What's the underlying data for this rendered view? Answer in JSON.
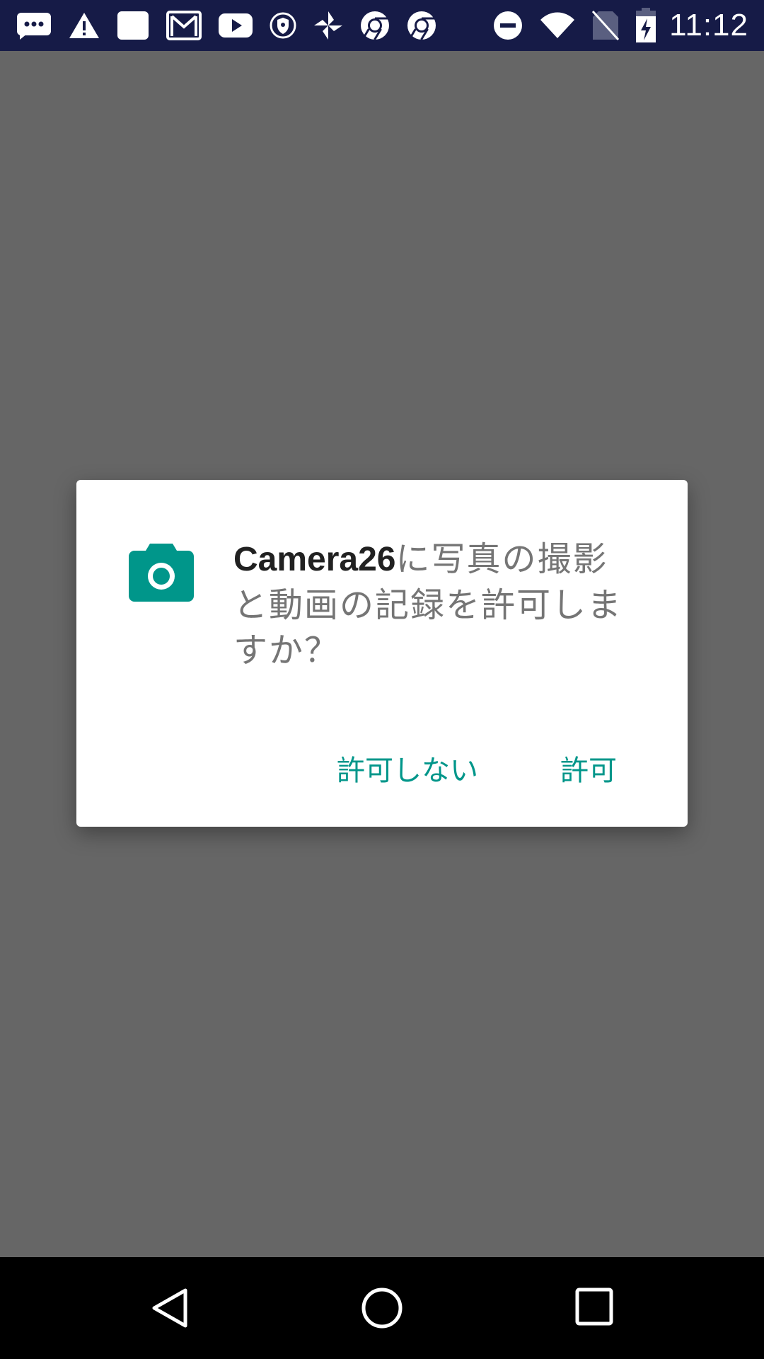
{
  "status_bar": {
    "time": "11:12",
    "left_icons": [
      "messages-icon",
      "warning-icon",
      "blank-app-icon",
      "gmail-icon",
      "youtube-icon",
      "shield-icon",
      "pinwheel-icon",
      "chrome-icon",
      "chrome-icon"
    ],
    "right_icons": [
      "do-not-disturb-icon",
      "wifi-icon",
      "no-sim-icon",
      "battery-charging-icon"
    ]
  },
  "dialog": {
    "icon": "camera-icon",
    "app_name": "Camera26",
    "message_rest": "に写真の撮影と動画の記録を許可しますか？",
    "deny_label": "許可しない",
    "allow_label": "許可",
    "accent_color": "#00968a"
  },
  "nav_bar": {
    "buttons": [
      "back-icon",
      "home-icon",
      "recents-icon"
    ]
  },
  "colors": {
    "status_bar_bg": "#161b47",
    "backdrop": "#666666",
    "dialog_bg": "#ffffff"
  }
}
